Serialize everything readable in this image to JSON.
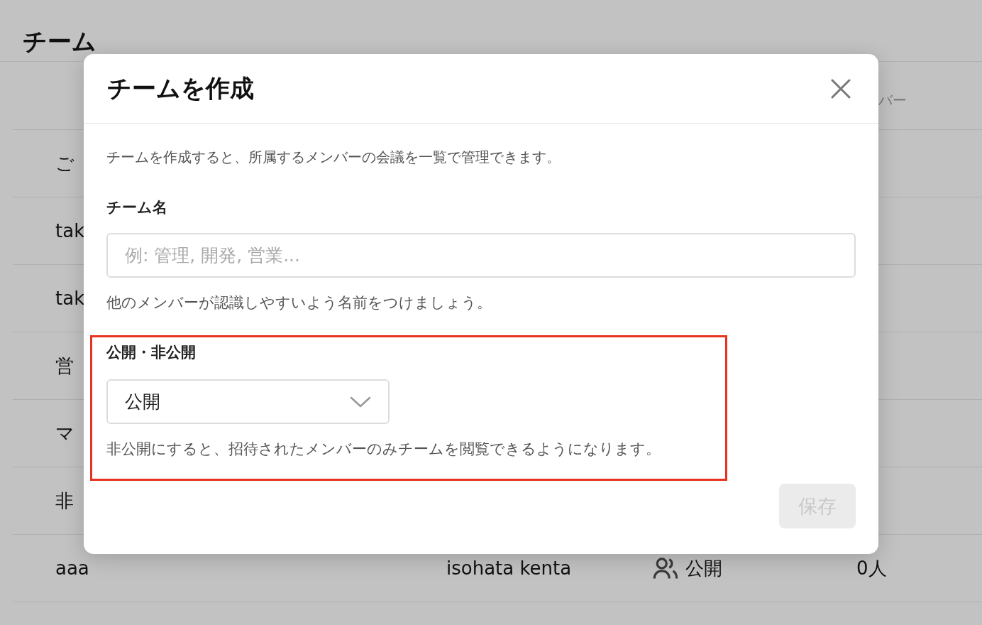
{
  "page": {
    "title": "チーム"
  },
  "table": {
    "header": {
      "column_4": "バー"
    },
    "rows": [
      {
        "name": "ご"
      },
      {
        "name": "tak"
      },
      {
        "name": "tak"
      },
      {
        "name": "営"
      },
      {
        "name": "マ"
      },
      {
        "name": "非"
      },
      {
        "name": "aaa",
        "owner": "isohata kenta",
        "visibility": "公開",
        "members": "0人"
      }
    ]
  },
  "dialog": {
    "title": "チームを作成",
    "description": "チームを作成すると、所属するメンバーの会議を一覧で管理できます。",
    "name_field": {
      "label": "チーム名",
      "placeholder": "例: 管理, 開発, 営業...",
      "help": "他のメンバーが認識しやすいよう名前をつけましょう。"
    },
    "visibility_field": {
      "label": "公開・非公開",
      "value": "公開",
      "help": "非公開にすると、招待されたメンバーのみチームを閲覧できるようになります。",
      "highlighted": true
    },
    "save_button": {
      "label": "保存",
      "disabled": true
    }
  }
}
